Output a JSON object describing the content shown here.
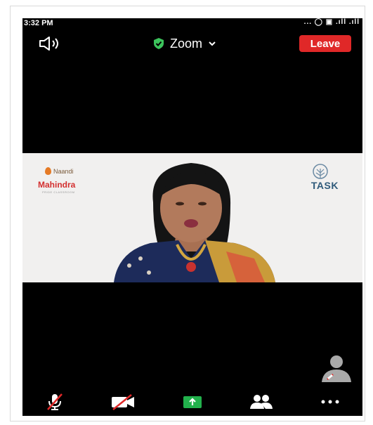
{
  "status_bar": {
    "time": "3:32 PM",
    "indicators": "... ◯ ▣ .ıll .ıll"
  },
  "header": {
    "title": "Zoom",
    "leave_label": "Leave",
    "icons": {
      "speaker": "speaker-icon",
      "encryption": "shield-check-icon",
      "dropdown": "chevron-down-icon"
    }
  },
  "video": {
    "logo_left_top": "Naandi",
    "logo_left_main": "Mahindra",
    "logo_left_sub": "PRIDE CLASSROOM",
    "logo_right": "TASK"
  },
  "toolbar": {
    "items": [
      {
        "icon": "mic-muted-icon"
      },
      {
        "icon": "video-off-icon"
      },
      {
        "icon": "share-screen-icon"
      },
      {
        "icon": "participants-icon"
      },
      {
        "icon": "more-icon"
      }
    ]
  },
  "colors": {
    "leave": "#e02828",
    "share": "#22b14c",
    "shield": "#3cc45c",
    "mute_slash": "#e02828"
  }
}
